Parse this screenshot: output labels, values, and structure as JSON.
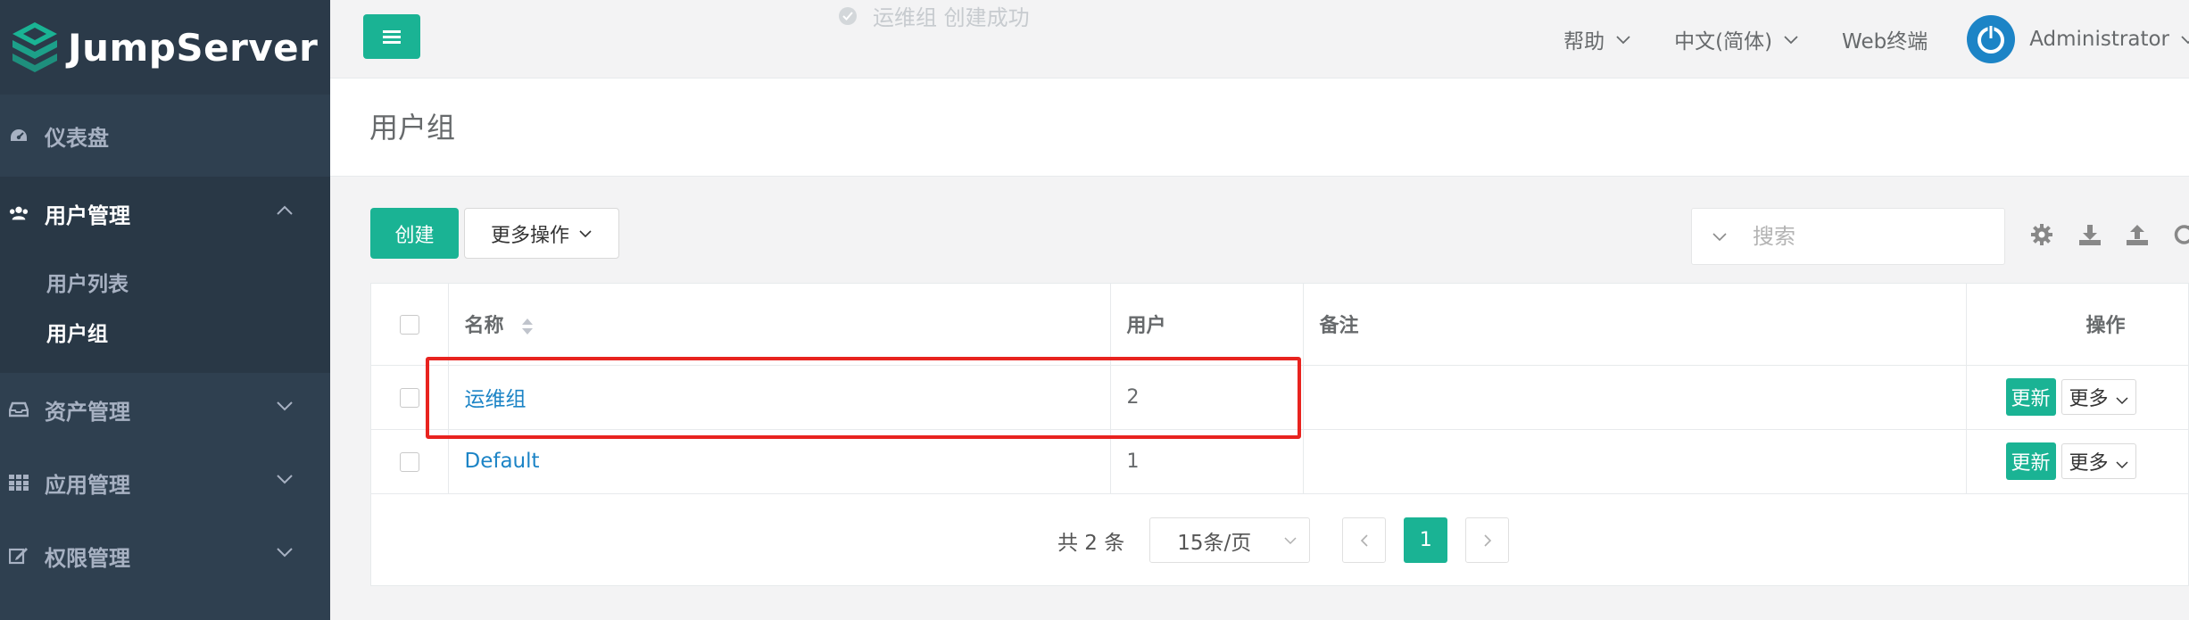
{
  "brand": {
    "name": "JumpServer"
  },
  "toast": {
    "text": "运维组 创建成功"
  },
  "topbar": {
    "help": "帮助",
    "language": "中文(简体)",
    "web_terminal": "Web终端",
    "user": "Administrator"
  },
  "sidebar": {
    "items": [
      {
        "label": "仪表盘",
        "icon": "dashboard-icon"
      },
      {
        "label": "用户管理",
        "icon": "users-icon",
        "expanded": true,
        "children": [
          {
            "label": "用户列表"
          },
          {
            "label": "用户组",
            "active": true
          }
        ]
      },
      {
        "label": "资产管理",
        "icon": "inbox-icon"
      },
      {
        "label": "应用管理",
        "icon": "grid-icon"
      },
      {
        "label": "权限管理",
        "icon": "edit-icon"
      }
    ]
  },
  "page": {
    "title": "用户组"
  },
  "toolbar": {
    "create_label": "创建",
    "more_actions_label": "更多操作",
    "search_placeholder": "搜索"
  },
  "table": {
    "columns": [
      "名称",
      "用户",
      "备注",
      "操作"
    ],
    "rows": [
      {
        "name": "运维组",
        "users": "2",
        "comment": "",
        "update": "更新",
        "more": "更多"
      },
      {
        "name": "Default",
        "users": "1",
        "comment": "",
        "update": "更新",
        "more": "更多"
      }
    ]
  },
  "pagination": {
    "total_text": "共 2 条",
    "page_size": "15条/页",
    "current_page": "1"
  },
  "colors": {
    "accent": "#1ab394",
    "sidebar": "#2f4050",
    "link": "#1c84c6",
    "highlight": "#e8231f"
  }
}
